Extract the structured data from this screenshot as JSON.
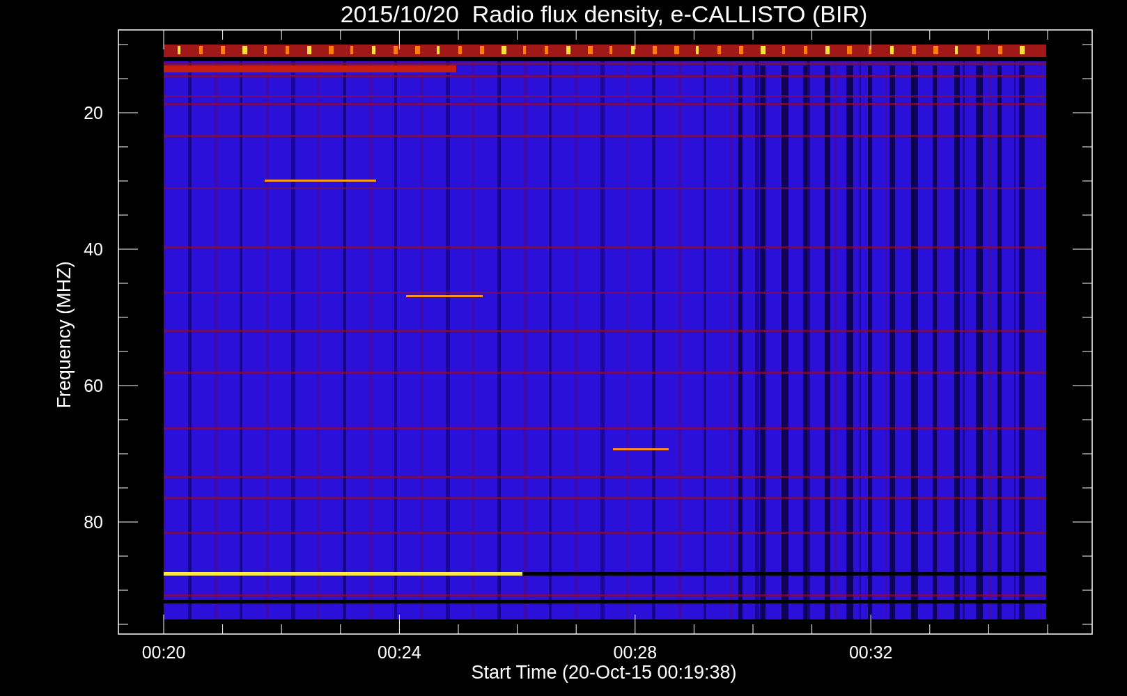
{
  "title": "2015/10/20  Radio flux density, e-CALLISTO (BIR)",
  "ylabel": "Frequency (MHZ)",
  "xlabel": "Start Time (20-Oct-15 00:19:38)",
  "yticks": [
    "20",
    "40",
    "60",
    "80"
  ],
  "xticks": [
    "00:20",
    "00:24",
    "00:28",
    "00:32"
  ]
}
